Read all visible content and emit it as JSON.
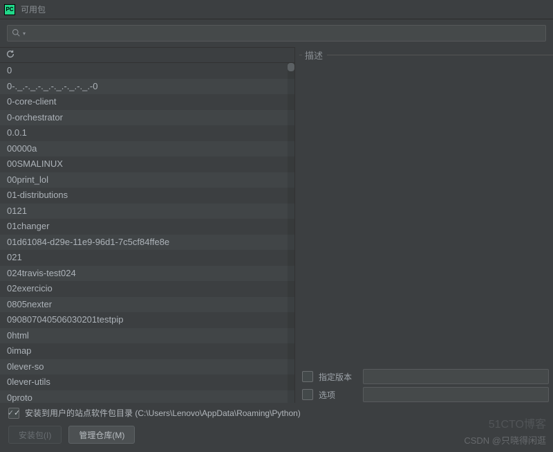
{
  "window": {
    "title": "可用包",
    "app_icon_label": "PC"
  },
  "search": {
    "placeholder": "",
    "value": ""
  },
  "packages": [
    "0",
    "0-._.-._.-._.-._.-._.-._.-0",
    "0-core-client",
    "0-orchestrator",
    "0.0.1",
    "00000a",
    "00SMALINUX",
    "00print_lol",
    "01-distributions",
    "0121",
    "01changer",
    "01d61084-d29e-11e9-96d1-7c5cf84ffe8e",
    "021",
    "024travis-test024",
    "02exercicio",
    "0805nexter",
    "090807040506030201testpip",
    "0html",
    "0imap",
    "0lever-so",
    "0lever-utils",
    "0proto"
  ],
  "description": {
    "section_label": "描述"
  },
  "options": {
    "specify_version_label": "指定版本",
    "options_label": "选项"
  },
  "footer": {
    "install_to_user_label": "安装到用户的站点软件包目录 (C:\\Users\\Lenovo\\AppData\\Roaming\\Python)",
    "install_button": "安装包(I)",
    "manage_repo_button": "管理仓库(M)"
  },
  "watermark": {
    "line1": "51CTO博客",
    "line2": "CSDN @只晓得闲逛"
  }
}
